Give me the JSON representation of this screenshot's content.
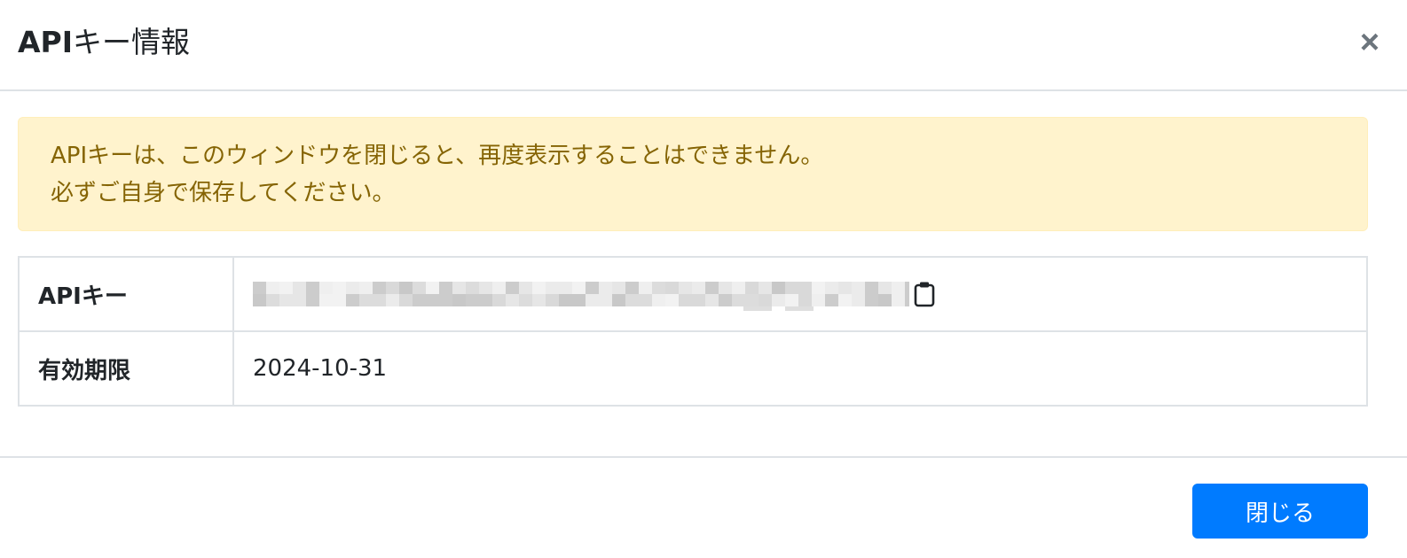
{
  "modal": {
    "title_prefix": "API",
    "title_suffix": "キー情報",
    "close_glyph": "×"
  },
  "alert": {
    "line1": "APIキーは、このウィンドウを閉じると、再度表示することはできません。",
    "line2": "必ずご自身で保存してください。"
  },
  "table": {
    "rows": [
      {
        "label": "APIキー",
        "value_masked": true,
        "icon": "clipboard-icon"
      },
      {
        "label": "有効期限",
        "value": "2024-10-31"
      }
    ]
  },
  "footer": {
    "close_label": "閉じる"
  },
  "colors": {
    "alert_bg": "#fff3cd",
    "alert_text": "#856404",
    "primary": "#007bff",
    "border": "#dee2e6"
  }
}
